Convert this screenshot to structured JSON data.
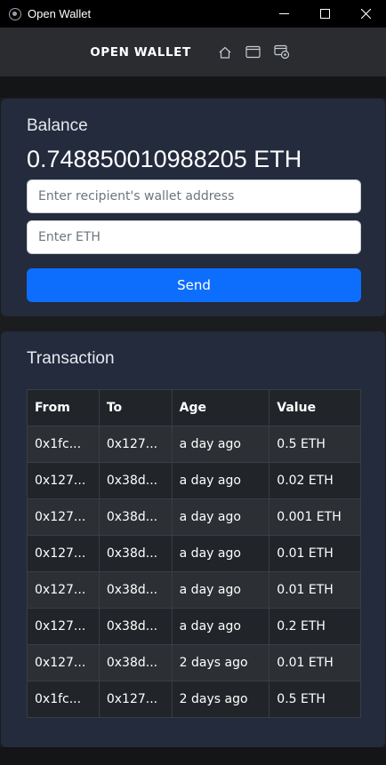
{
  "window": {
    "title": "Open Wallet",
    "controls": [
      "minimize-icon",
      "maximize-icon",
      "close-icon"
    ]
  },
  "navbar": {
    "brand": "OPEN WALLET",
    "icons": [
      "home-icon",
      "window-icon",
      "wallet-settings-icon"
    ]
  },
  "balance": {
    "label": "Balance",
    "value": "0.748850010988205 ETH",
    "address_placeholder": "Enter recipient's wallet address",
    "address_value": "",
    "eth_placeholder": "Enter ETH",
    "eth_value": "",
    "send_label": "Send"
  },
  "transactions": {
    "title": "Transaction",
    "headers": [
      "From",
      "To",
      "Age",
      "Value"
    ],
    "rows": [
      {
        "from": "0x1fc...",
        "to": "0x127...",
        "age": "a day ago",
        "value": "0.5 ETH"
      },
      {
        "from": "0x127...",
        "to": "0x38d...",
        "age": "a day ago",
        "value": "0.02 ETH"
      },
      {
        "from": "0x127...",
        "to": "0x38d...",
        "age": "a day ago",
        "value": "0.001 ETH"
      },
      {
        "from": "0x127...",
        "to": "0x38d...",
        "age": "a day ago",
        "value": "0.01 ETH"
      },
      {
        "from": "0x127...",
        "to": "0x38d...",
        "age": "a day ago",
        "value": "0.01 ETH"
      },
      {
        "from": "0x127...",
        "to": "0x38d...",
        "age": "a day ago",
        "value": "0.2 ETH"
      },
      {
        "from": "0x127...",
        "to": "0x38d...",
        "age": "2 days ago",
        "value": "0.01 ETH"
      },
      {
        "from": "0x1fc...",
        "to": "0x127...",
        "age": "2 days ago",
        "value": "0.5 ETH"
      }
    ]
  },
  "colors": {
    "accent": "#0d6efd",
    "card": "#232b3d",
    "navbar": "#2a2c30",
    "titlebar": "#000000"
  }
}
